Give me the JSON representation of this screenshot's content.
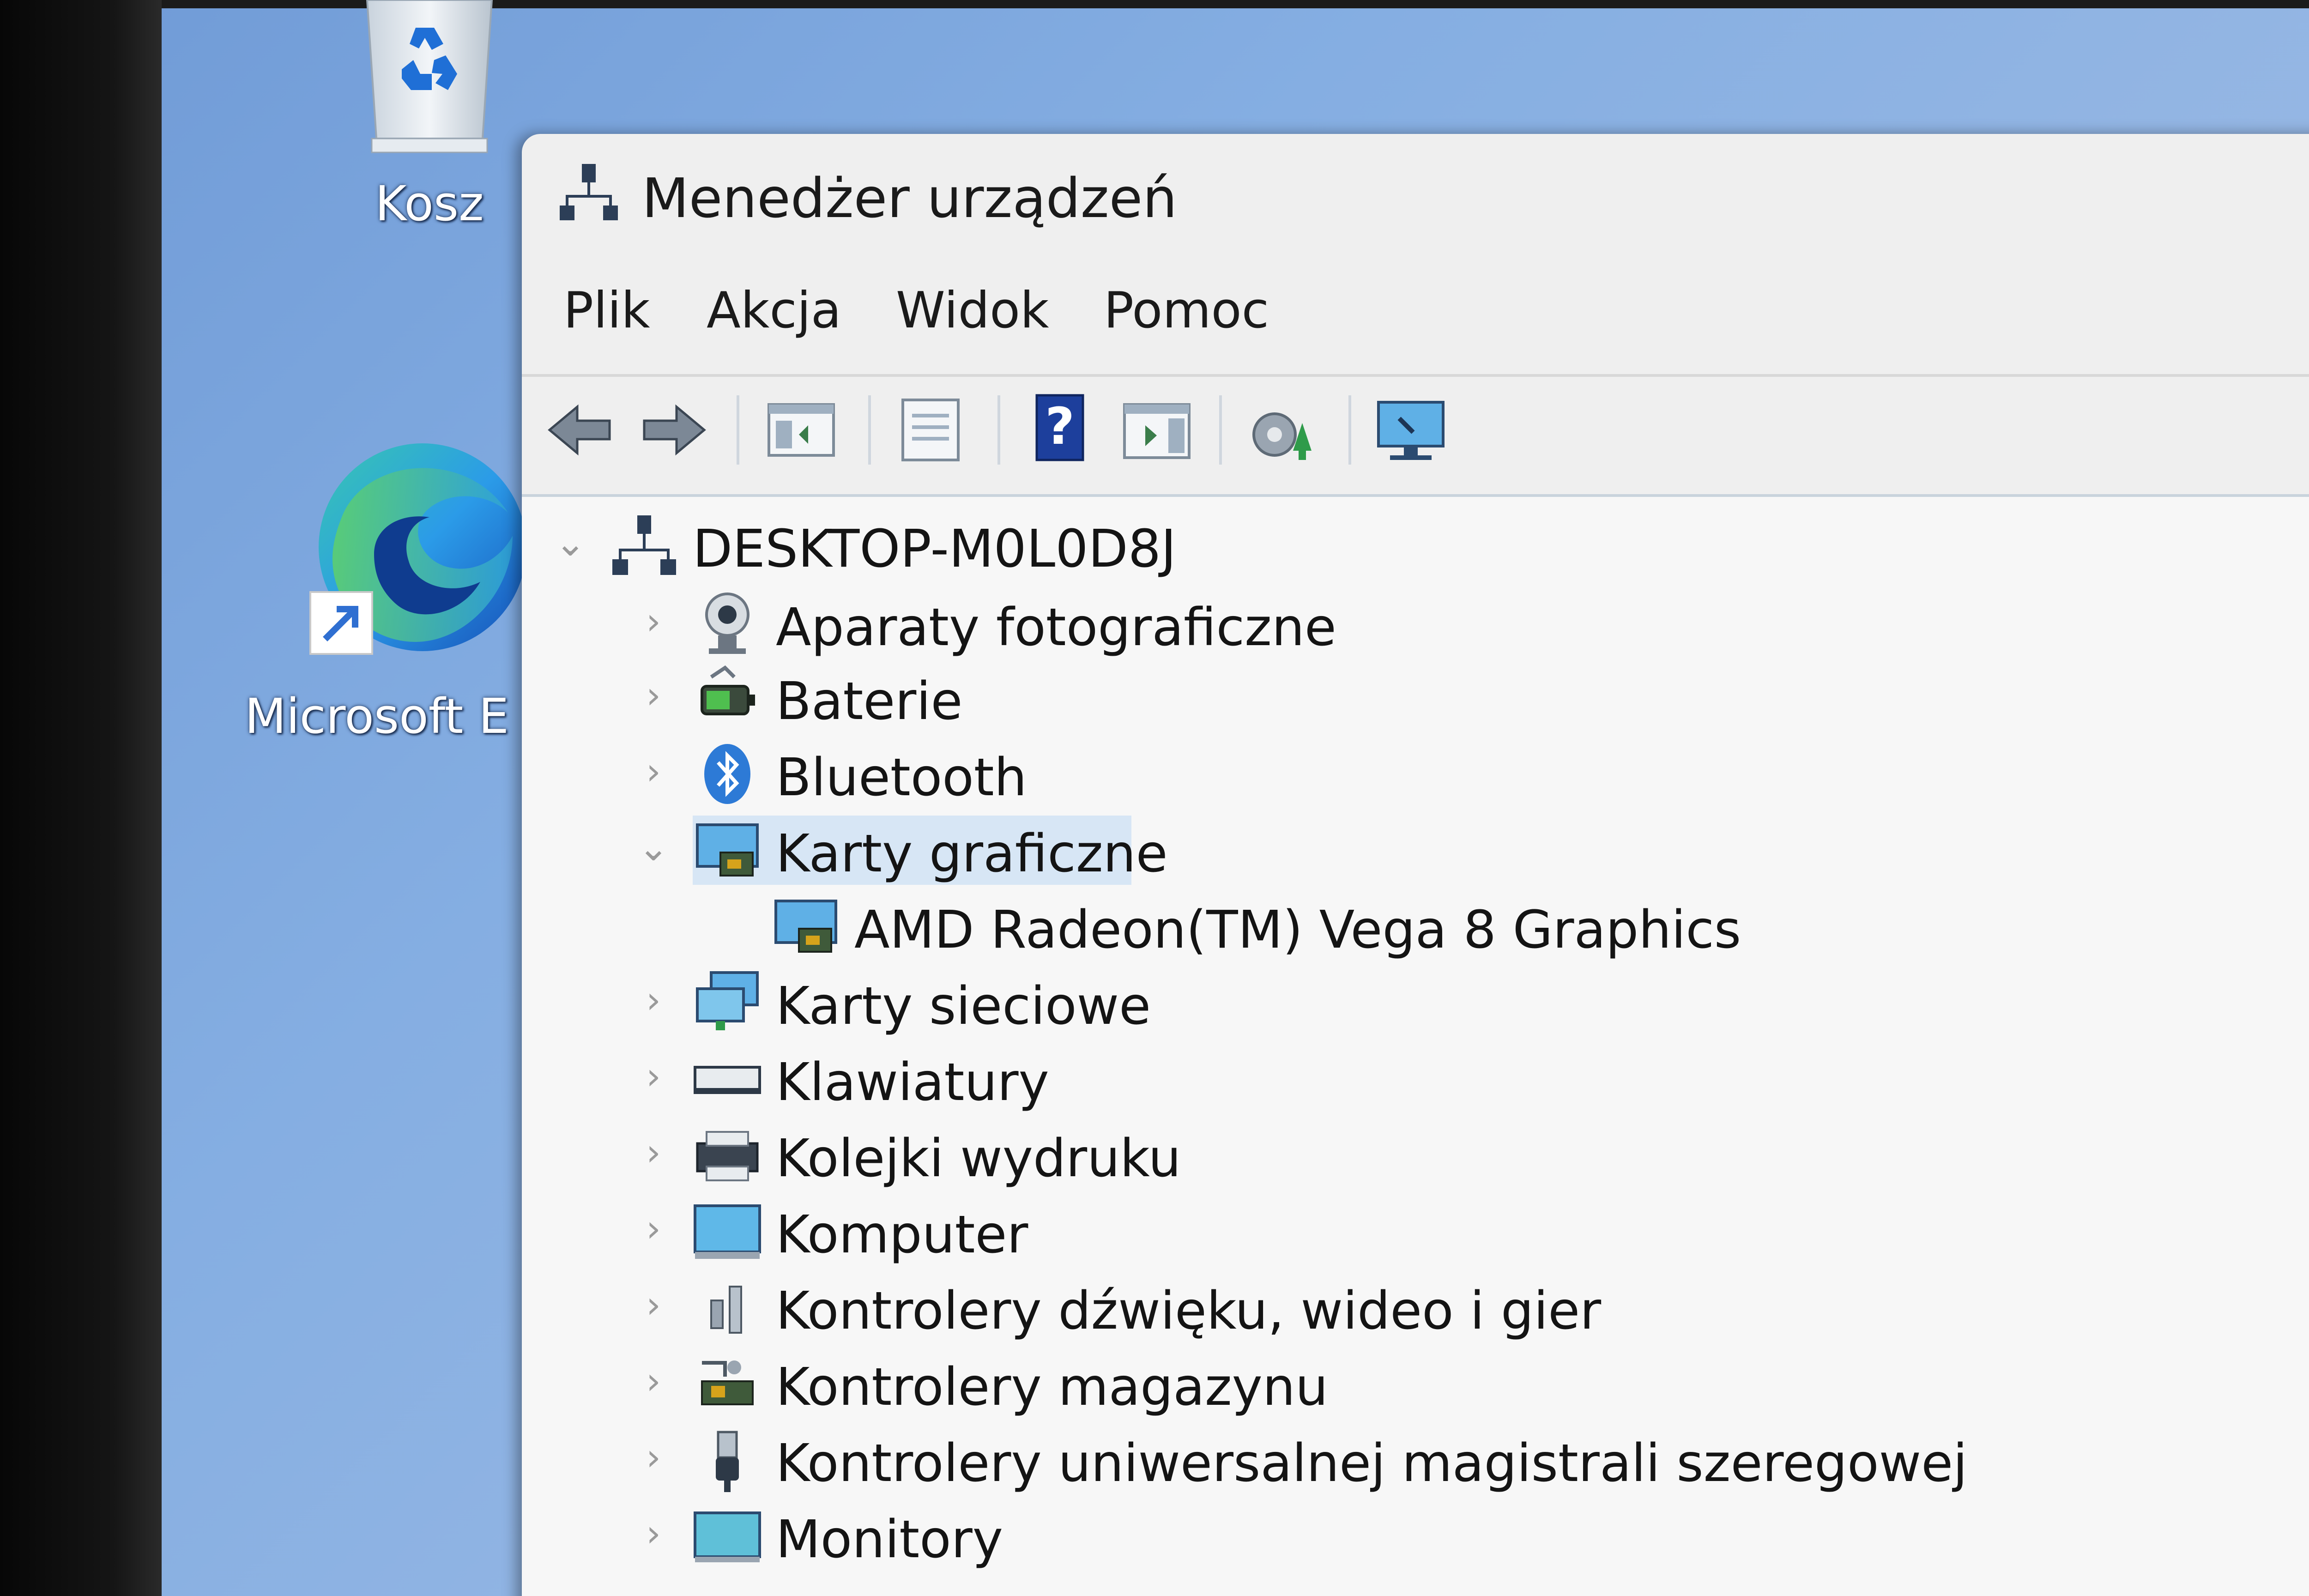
{
  "desktop": {
    "icons": [
      {
        "label": "Kosz",
        "icon": "recycle-bin-icon"
      },
      {
        "label": "Microsoft E",
        "icon": "edge-browser-icon"
      }
    ]
  },
  "window": {
    "title": "Menedżer urządzeń",
    "menu": [
      "Plik",
      "Akcja",
      "Widok",
      "Pomoc"
    ],
    "toolbar": [
      "back-icon",
      "forward-icon",
      "show-hide-console-tree-icon",
      "properties-icon",
      "help-icon",
      "action-pane-icon",
      "update-driver-icon",
      "scan-hardware-icon"
    ]
  },
  "tree": {
    "root": "DESKTOP-M0L0D8J",
    "items": [
      {
        "label": "Aparaty fotograficzne",
        "icon": "camera-icon",
        "expanded": false
      },
      {
        "label": "Baterie",
        "icon": "battery-icon",
        "expanded": false
      },
      {
        "label": "Bluetooth",
        "icon": "bluetooth-icon",
        "expanded": false
      },
      {
        "label": "Karty graficzne",
        "icon": "display-adapter-icon",
        "expanded": true,
        "selected": true,
        "children": [
          {
            "label": "AMD Radeon(TM) Vega 8 Graphics",
            "icon": "display-adapter-icon"
          }
        ]
      },
      {
        "label": "Karty sieciowe",
        "icon": "network-adapter-icon",
        "expanded": false
      },
      {
        "label": "Klawiatury",
        "icon": "keyboard-icon",
        "expanded": false
      },
      {
        "label": "Kolejki wydruku",
        "icon": "printer-icon",
        "expanded": false
      },
      {
        "label": "Komputer",
        "icon": "computer-icon",
        "expanded": false
      },
      {
        "label": "Kontrolery dźwięku, wideo i gier",
        "icon": "sound-icon",
        "expanded": false
      },
      {
        "label": "Kontrolery magazynu",
        "icon": "storage-controller-icon",
        "expanded": false
      },
      {
        "label": "Kontrolery uniwersalnej magistrali szeregowej",
        "icon": "usb-icon",
        "expanded": false
      },
      {
        "label": "Monitory",
        "icon": "monitor-icon",
        "expanded": false
      }
    ]
  },
  "colors": {
    "desktop": "#85aee2",
    "window": "#efefef",
    "selection": "#d7e6f5"
  }
}
